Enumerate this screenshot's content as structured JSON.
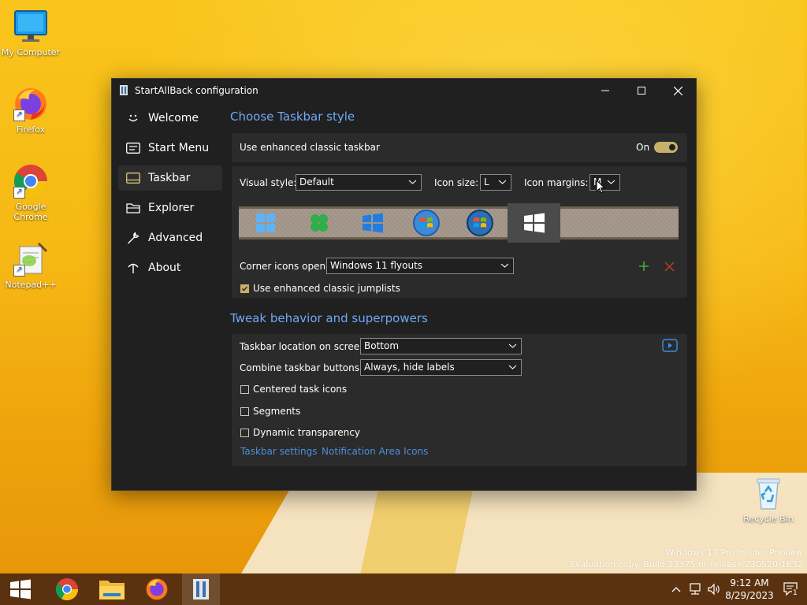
{
  "desktop": {
    "icons": [
      {
        "label": "My Computer"
      },
      {
        "label": "Firefox"
      },
      {
        "label": "Google Chrome"
      },
      {
        "label": "Notepad++"
      },
      {
        "label": "Recycle Bin"
      }
    ],
    "watermark": {
      "line1": "Windows 11 Pro Insider Preview",
      "line2": "Evaluation copy. Build 23375.ni_release.230520-1632"
    }
  },
  "window": {
    "title": "StartAllBack configuration",
    "controls": {
      "minimize": "minimize-icon",
      "maximize": "maximize-icon",
      "close": "close-icon"
    }
  },
  "sidebar": {
    "items": [
      {
        "label": "Welcome",
        "icon": "smile-icon"
      },
      {
        "label": "Start Menu",
        "icon": "start-menu-icon"
      },
      {
        "label": "Taskbar",
        "icon": "taskbar-icon",
        "selected": true
      },
      {
        "label": "Explorer",
        "icon": "explorer-icon"
      },
      {
        "label": "Advanced",
        "icon": "wrench-icon"
      },
      {
        "label": "About",
        "icon": "about-icon"
      }
    ]
  },
  "style_section": {
    "heading": "Choose Taskbar style",
    "enhanced_taskbar_label": "Use enhanced classic taskbar",
    "toggle_state": "On",
    "visual_style_label": "Visual style:",
    "visual_style_value": "Default",
    "icon_size_label": "Icon size:",
    "icon_size_value": "L",
    "icon_margins_label": "Icon margins:",
    "icon_margins_value": "M",
    "corner_icons_label": "Corner icons open:",
    "corner_icons_value": "Windows 11 flyouts",
    "jumplists_label": "Use enhanced classic jumplists",
    "jumplists_checked": true
  },
  "behavior_section": {
    "heading": "Tweak behavior and superpowers",
    "location_label": "Taskbar location on screen:",
    "location_value": "Bottom",
    "combine_label": "Combine taskbar buttons:",
    "combine_value": "Always, hide labels",
    "centered_label": "Centered task icons",
    "segments_label": "Segments",
    "transparency_label": "Dynamic transparency",
    "link_taskbar_settings": "Taskbar settings",
    "link_notification_icons": "Notification Area Icons"
  },
  "taskbar": {
    "time": "9:12 AM",
    "date": "8/29/2023",
    "notification_count": "1"
  },
  "colors": {
    "accent": "#6fa9f4",
    "toggle": "#c9b06a",
    "taskbar": "#5b320f",
    "window_bg": "#202020",
    "panel_bg": "#2b2b2b"
  }
}
